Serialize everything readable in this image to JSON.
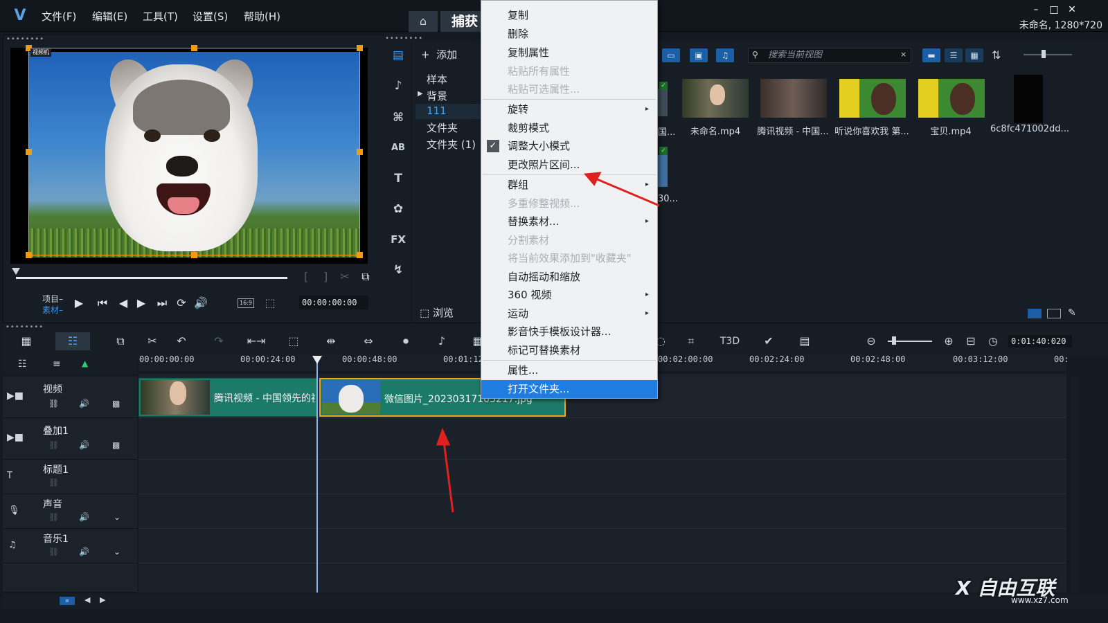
{
  "menubar": {
    "items": [
      "文件(F)",
      "编辑(E)",
      "工具(T)",
      "设置(S)",
      "帮助(H)"
    ]
  },
  "tabs": {
    "capture": "捕获"
  },
  "project_info": "未命名, 1280*720",
  "preview": {
    "tag": "视频机",
    "mode_project": "项目",
    "mode_clip": "素材",
    "timecode": "00:00:00:00",
    "aspect": "16:9"
  },
  "library": {
    "add_label": "添加",
    "folders": [
      "样本",
      "背景",
      "111",
      "文件夹",
      "文件夹 (1)"
    ],
    "browse_label": "浏览",
    "search_placeholder": "搜索当前视图",
    "thumbnails": [
      {
        "label": "未命名.mp4"
      },
      {
        "label": "腾讯视频 - 中国..."
      },
      {
        "label": "听说你喜欢我 第..."
      },
      {
        "label": "宝贝.mp4"
      },
      {
        "label": "6c8fc471002dd..."
      }
    ],
    "partial_labels": [
      "国...",
      "30..."
    ]
  },
  "context_menu": {
    "items": [
      {
        "label": "复制",
        "disabled": false
      },
      {
        "label": "删除",
        "disabled": false
      },
      {
        "label": "复制属性",
        "disabled": false
      },
      {
        "label": "粘贴所有属性",
        "disabled": true
      },
      {
        "label": "粘贴可选属性...",
        "disabled": true
      },
      {
        "label": "旋转",
        "disabled": false,
        "submenu": true
      },
      {
        "label": "裁剪模式",
        "disabled": false
      },
      {
        "label": "调整大小模式",
        "disabled": false,
        "checked": true
      },
      {
        "label": "更改照片区间...",
        "disabled": false
      },
      {
        "label": "群组",
        "disabled": false,
        "submenu": true
      },
      {
        "label": "多重修整视频...",
        "disabled": true
      },
      {
        "label": "替换素材...",
        "disabled": false,
        "submenu": true
      },
      {
        "label": "分割素材",
        "disabled": true
      },
      {
        "label": "将当前效果添加到\"收藏夹\"",
        "disabled": true
      },
      {
        "label": "自动摇动和缩放",
        "disabled": false
      },
      {
        "label": "360 视频",
        "disabled": false,
        "submenu": true
      },
      {
        "label": "运动",
        "disabled": false,
        "submenu": true
      },
      {
        "label": "影音快手模板设计器...",
        "disabled": false
      },
      {
        "label": "标记可替换素材",
        "disabled": false
      },
      {
        "label": "属性...",
        "disabled": false
      },
      {
        "label": "打开文件夹...",
        "disabled": false,
        "highlighted": true
      }
    ]
  },
  "timeline": {
    "timecode": "0:01:40:020",
    "ruler": [
      "00:00:00:00",
      "00:00:24:00",
      "00:00:48:00",
      "00:01:12",
      "00:02:00:00",
      "00:02:24:00",
      "00:02:48:00",
      "00:03:12:00",
      "00:"
    ],
    "tracks": [
      "视频",
      "叠加1",
      "标题1",
      "声音",
      "音乐1"
    ],
    "clips": [
      {
        "label": "腾讯视频 - 中国领先的视"
      },
      {
        "label": "微信图片_20230317105217.jpg"
      }
    ]
  },
  "watermark": {
    "brand": "X 自由互联",
    "url": "www.xz7.com"
  },
  "colors": {
    "accent": "#1f7ce0",
    "clip": "#1c7b68",
    "selection": "#f2a31b",
    "annotation_arrow": "#e0201f"
  }
}
